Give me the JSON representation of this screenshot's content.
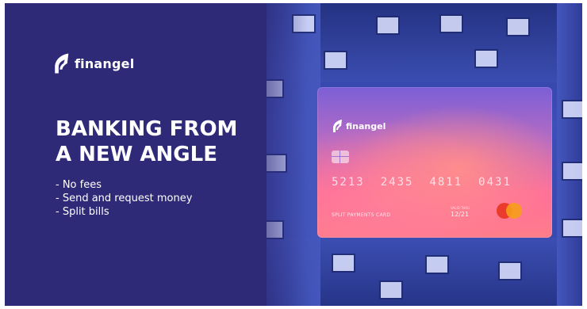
{
  "brand": {
    "name": "finangel"
  },
  "headline": {
    "line1": "BANKING FROM",
    "line2": "A NEW ANGLE"
  },
  "features": [
    "- No fees",
    "- Send and request money",
    "- Split bills"
  ],
  "card": {
    "brand": "finangel",
    "number_groups": [
      "5213",
      "2435",
      "4811",
      "0431"
    ],
    "type_label": "SPLIT PAYMENTS CARD",
    "valid_label": "VALID THRU",
    "expiry": "12/21",
    "network": "mastercard-logo"
  },
  "colors": {
    "background": "#2e2a78",
    "text": "#ffffff",
    "card_pink": "#ff6f9a",
    "card_purple": "#7b5fd6",
    "mc_red": "#eb3b2c",
    "mc_orange": "#f79e1b"
  }
}
